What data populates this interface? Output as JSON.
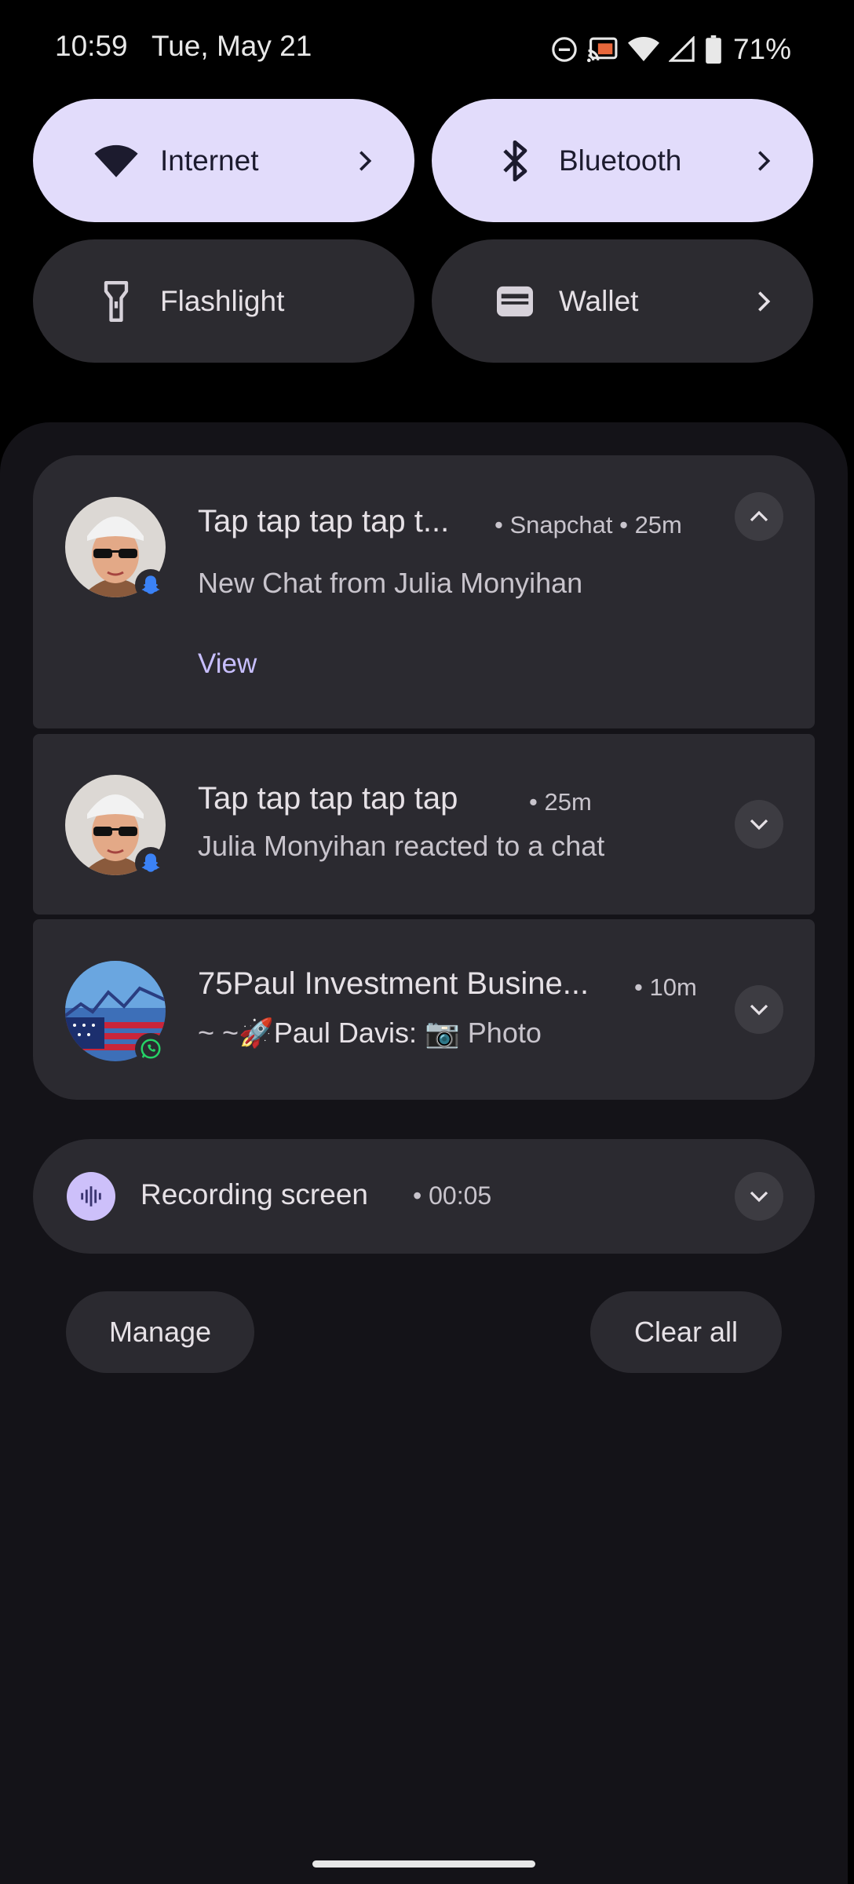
{
  "status_bar": {
    "time": "10:59",
    "date": "Tue, May 21",
    "battery": "71%",
    "icons": [
      "do-not-disturb-icon",
      "cast-icon",
      "wifi-icon",
      "cell-signal-icon",
      "battery-icon"
    ]
  },
  "quick_tiles": [
    {
      "label": "Internet",
      "icon": "wifi-icon",
      "state": "on",
      "has_chevron": true
    },
    {
      "label": "Bluetooth",
      "icon": "bluetooth-icon",
      "state": "on",
      "has_chevron": true
    },
    {
      "label": "Flashlight",
      "icon": "flashlight-icon",
      "state": "off",
      "has_chevron": false
    },
    {
      "label": "Wallet",
      "icon": "wallet-icon",
      "state": "off",
      "has_chevron": true
    }
  ],
  "notifications": [
    {
      "title": "Tap tap tap tap t...",
      "app": "Snapchat",
      "time": "25m",
      "body": "New Chat from Julia Monyihan",
      "action": "View",
      "expanded": true,
      "badge": "snapchat-icon"
    },
    {
      "title": "Tap tap tap tap tap",
      "time": "25m",
      "body": "Julia Monyihan reacted to a chat",
      "expanded": false,
      "badge": "snapchat-icon"
    },
    {
      "title": "75Paul Investment Busine...",
      "time": "10m",
      "body_prefix": "~ ~🚀",
      "body_sender": "Paul Davis:",
      "body_text": "📷 Photo",
      "expanded": false,
      "badge": "whatsapp-icon"
    }
  ],
  "recording": {
    "title": "Recording screen",
    "elapsed": "00:05"
  },
  "footer": {
    "manage_label": "Manage",
    "clear_all_label": "Clear all"
  },
  "colors": {
    "tile_on": "#e2dcfb",
    "tile_off": "#2c2b30",
    "card": "#2b2a30",
    "accent_action": "#c8bfff",
    "snapchat_badge": "#3b82f6",
    "whatsapp_badge": "#25d366"
  }
}
